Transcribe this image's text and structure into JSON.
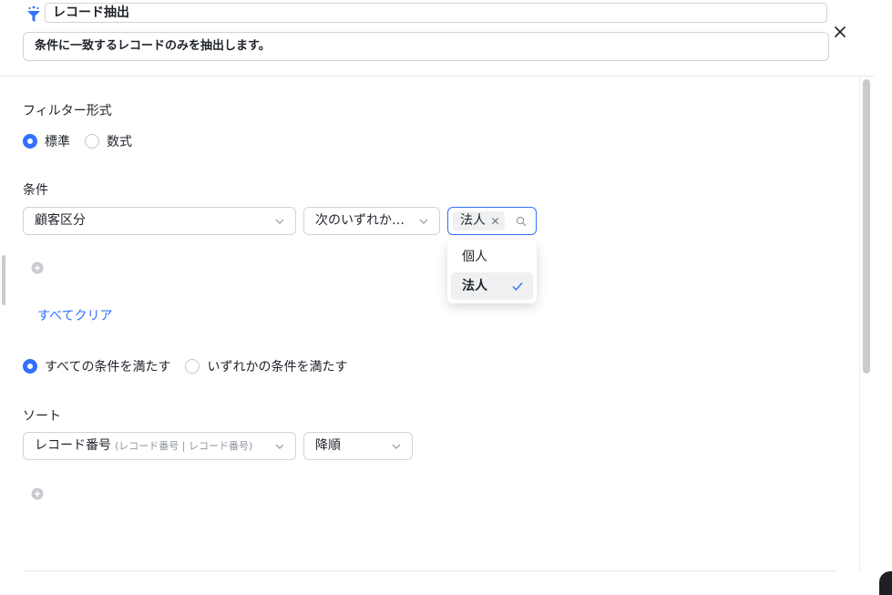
{
  "header": {
    "title": "レコード抽出",
    "description": "条件に一致するレコードのみを抽出します。"
  },
  "filter_format": {
    "label": "フィルター形式",
    "options": [
      {
        "label": "標準",
        "selected": true
      },
      {
        "label": "数式",
        "selected": false
      }
    ]
  },
  "conditions": {
    "label": "条件",
    "field": "顧客区分",
    "operator": "次のいずれか…",
    "selected_tag": "法人",
    "dropdown_options": [
      {
        "label": "個人",
        "selected": false
      },
      {
        "label": "法人",
        "selected": true
      }
    ],
    "clear_all": "すべてクリア"
  },
  "match_mode": {
    "options": [
      {
        "label": "すべての条件を満たす",
        "selected": true
      },
      {
        "label": "いずれかの条件を満たす",
        "selected": false
      }
    ]
  },
  "sort": {
    "label": "ソート",
    "field": "レコード番号",
    "field_sub": "(レコード番号 | レコード番号)",
    "order": "降順"
  },
  "colors": {
    "accent": "#3370ff",
    "border": "#d0d3d6",
    "text": "#1f2329",
    "muted": "#8f959e"
  }
}
